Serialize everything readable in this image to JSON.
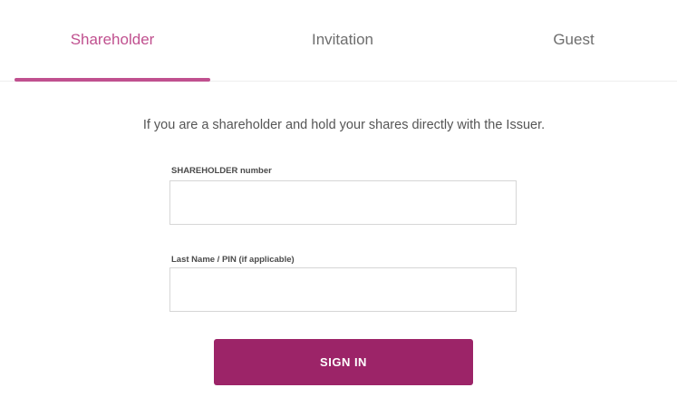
{
  "tabs": [
    {
      "label": "Shareholder",
      "active": true
    },
    {
      "label": "Invitation",
      "active": false
    },
    {
      "label": "Guest",
      "active": false
    }
  ],
  "intro": "If you are a shareholder and hold your shares directly with the Issuer.",
  "form": {
    "shareholder_number": {
      "label": "SHAREHOLDER number",
      "value": "",
      "placeholder": ""
    },
    "last_name_pin": {
      "label": "Last Name / PIN (if applicable)",
      "value": "",
      "placeholder": ""
    },
    "submit_label": "SIGN IN"
  },
  "colors": {
    "accent": "#c0508f",
    "button": "#9c2468",
    "text": "#555555"
  }
}
